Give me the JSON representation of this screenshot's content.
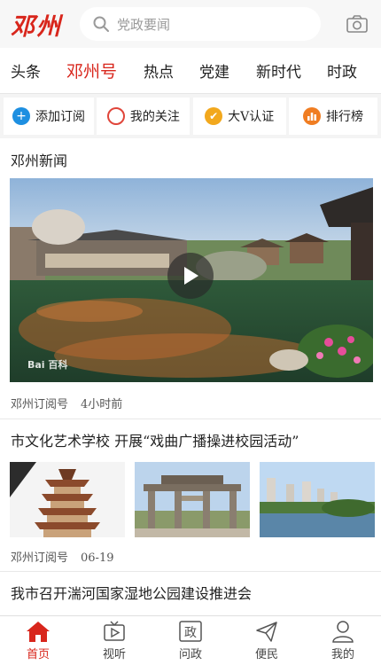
{
  "header": {
    "logo": "邓州",
    "search_placeholder": "党政要闻"
  },
  "tabs": [
    {
      "label": "头条",
      "active": false
    },
    {
      "label": "邓州号",
      "active": true
    },
    {
      "label": "热点",
      "active": false
    },
    {
      "label": "党建",
      "active": false
    },
    {
      "label": "新时代",
      "active": false
    },
    {
      "label": "时政",
      "active": false
    }
  ],
  "quick_actions": [
    {
      "label": "添加订阅",
      "icon": "plus-icon",
      "color": "#1d8fe1"
    },
    {
      "label": "我的关注",
      "icon": "circle-icon",
      "color": "#e0453a"
    },
    {
      "label": "大V认证",
      "icon": "v-badge-icon",
      "color": "#f2a81d"
    },
    {
      "label": "排行榜",
      "icon": "bar-chart-icon",
      "color": "#f07d22"
    }
  ],
  "section": {
    "title": "邓州新闻"
  },
  "feed": {
    "video_item": {
      "watermark": "Bai 百科",
      "source": "邓州订阅号",
      "time": "4小时前"
    },
    "article_1": {
      "title": "市文化艺术学校 开展“戏曲广播操进校园活动”",
      "source": "邓州订阅号",
      "time": "06-19"
    },
    "article_2": {
      "title": "我市召开湍河国家湿地公园建设推进会"
    }
  },
  "bottom_nav": [
    {
      "label": "首页",
      "icon": "home-icon",
      "active": true
    },
    {
      "label": "视听",
      "icon": "tv-icon",
      "active": false
    },
    {
      "label": "问政",
      "icon": "zheng-icon",
      "active": false
    },
    {
      "label": "便民",
      "icon": "send-icon",
      "active": false
    },
    {
      "label": "我的",
      "icon": "user-icon",
      "active": false
    }
  ],
  "colors": {
    "accent": "#d8261c"
  }
}
